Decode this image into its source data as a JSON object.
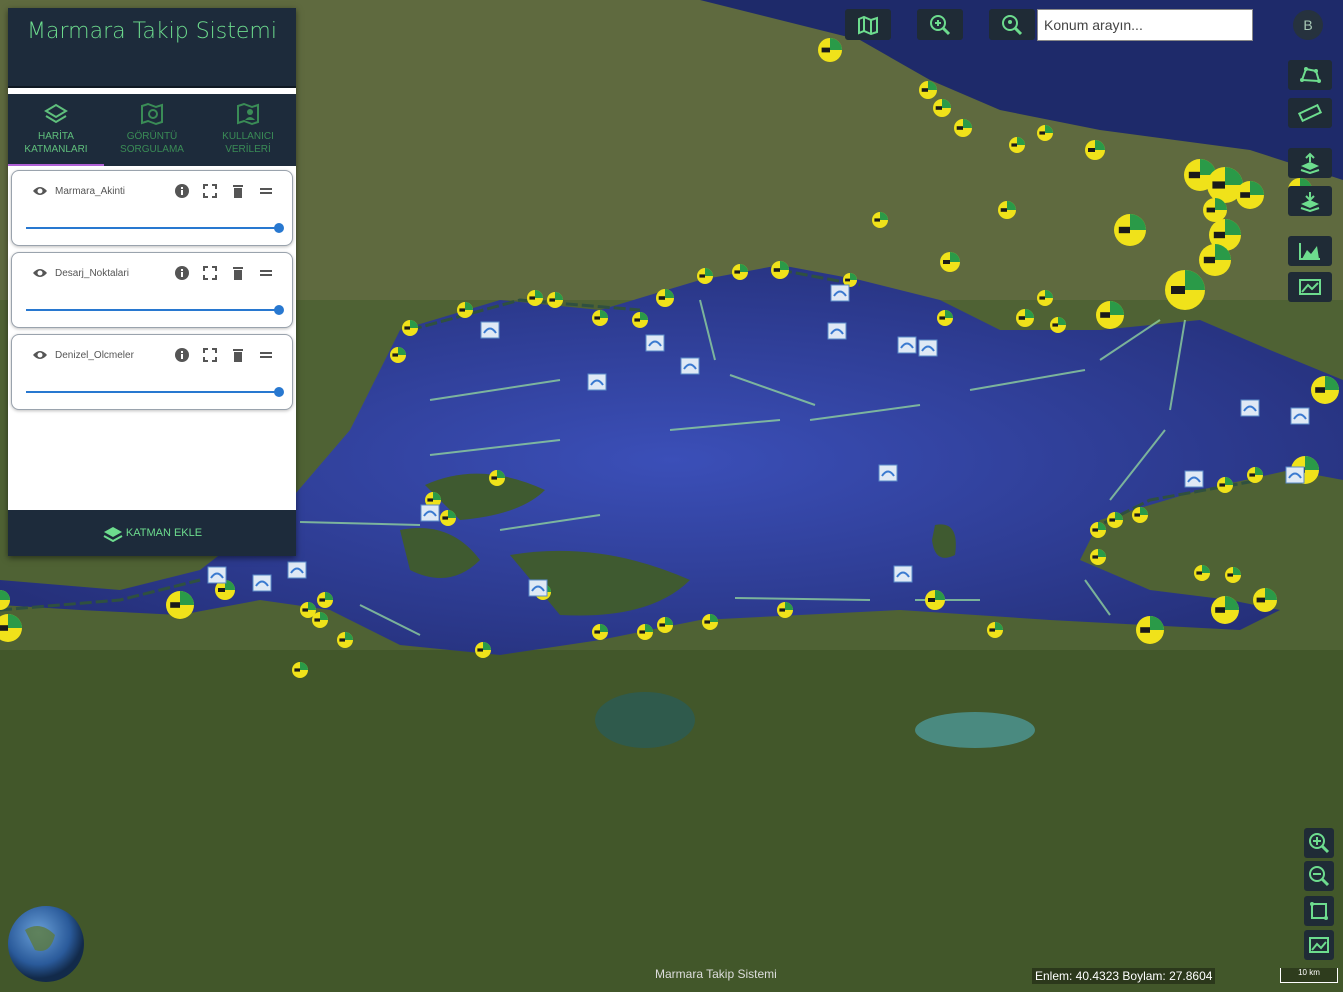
{
  "app": {
    "title": "Marmara Takip Sistemi"
  },
  "tabs": [
    {
      "label": "HARİTA\nKATMANLARI",
      "icon": "layers-icon",
      "active": true
    },
    {
      "label": "GÖRÜNTÜ\nSORGULAMA",
      "icon": "map-search-icon",
      "active": false
    },
    {
      "label": "KULLANICI\nVERİLERİ",
      "icon": "user-data-icon",
      "active": false
    }
  ],
  "layers": [
    {
      "name": "Marmara_Akinti",
      "opacity": 1.0
    },
    {
      "name": "Desarj_Noktalari",
      "opacity": 1.0
    },
    {
      "name": "Denizel_Olcmeler",
      "opacity": 1.0
    }
  ],
  "footer": {
    "add_layer_label": "KATMAN EKLE"
  },
  "search": {
    "placeholder": "Konum arayın..."
  },
  "user": {
    "initial": "B"
  },
  "status": {
    "coords": "Enlem: 40.4323 Boylam: 27.8604",
    "scale": "10 km",
    "attribution": "Marmara Takip Sistemi"
  },
  "colors": {
    "accent": "#6ddc8e",
    "panel": "#1d2b3b",
    "slider": "#2878d0",
    "sea": "#2d3e9a"
  }
}
